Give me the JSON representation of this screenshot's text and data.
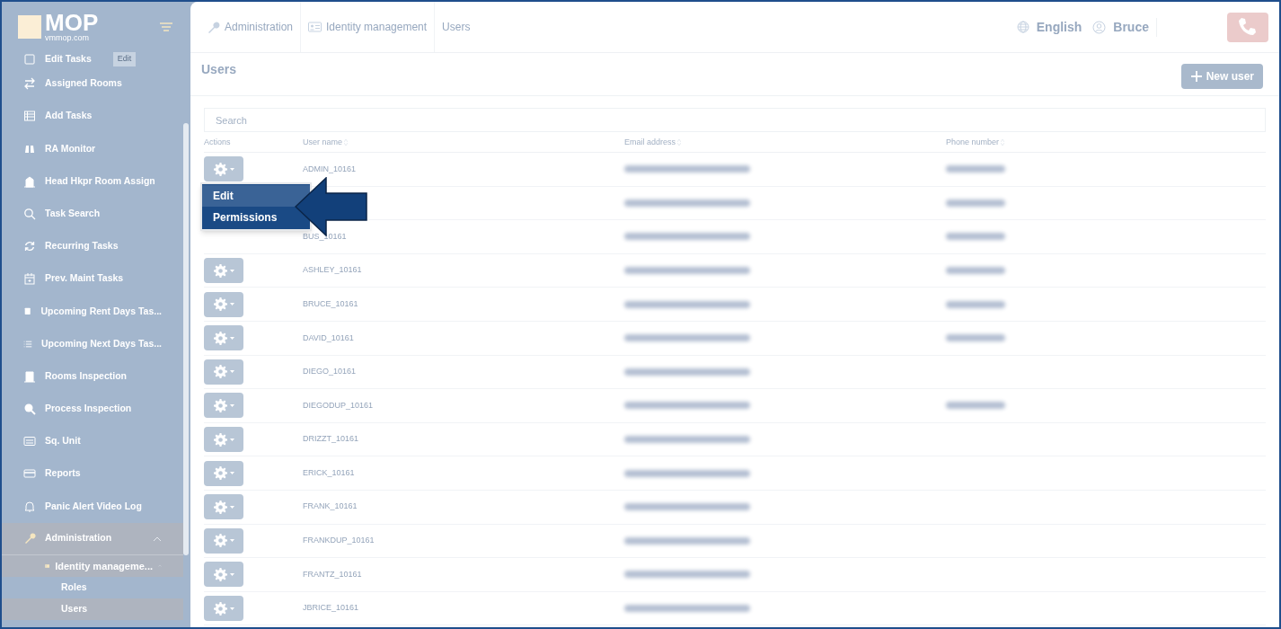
{
  "logo": {
    "title": "MOP",
    "subtitle": "vmmop.com"
  },
  "sidebar": {
    "items": [
      {
        "label": "Edit Tasks",
        "badge": "Edit"
      },
      {
        "label": "Assigned Rooms"
      },
      {
        "label": "Add Tasks"
      },
      {
        "label": "RA Monitor"
      },
      {
        "label": "Head Hkpr Room Assign"
      },
      {
        "label": "Task Search"
      },
      {
        "label": "Recurring Tasks"
      },
      {
        "label": "Prev. Maint Tasks"
      },
      {
        "label": "Upcoming Rent Days Tas..."
      },
      {
        "label": "Upcoming Next Days Tas..."
      },
      {
        "label": "Rooms Inspection"
      },
      {
        "label": "Process Inspection"
      },
      {
        "label": "Sq. Unit"
      },
      {
        "label": "Reports"
      },
      {
        "label": "Panic Alert Video Log"
      },
      {
        "label": "Administration",
        "expanded": true,
        "children": [
          {
            "label": "Identity manageme...",
            "expanded": true,
            "children": [
              {
                "label": "Roles",
                "selected": false
              },
              {
                "label": "Users",
                "selected": true
              }
            ]
          }
        ]
      }
    ]
  },
  "breadcrumb": [
    "Administration",
    "Identity management",
    "Users"
  ],
  "header": {
    "language": "English",
    "user": "Bruce"
  },
  "page": {
    "title": "Users",
    "new_button": "New user"
  },
  "search": {
    "placeholder": "Search"
  },
  "table": {
    "columns": [
      "Actions",
      "User name",
      "Email address",
      "Phone number"
    ],
    "rows": [
      {
        "user_name": "ADMIN_10161",
        "actions": true,
        "menu_open": true,
        "email_redacted": true,
        "phone_redacted": true
      },
      {
        "actions": false,
        "menu_open": false,
        "email_redacted": true,
        "phone_redacted": true
      },
      {
        "user_name": "BUS_10161",
        "actions": false,
        "menu_open": false,
        "email_redacted": true,
        "phone_redacted": true
      },
      {
        "user_name": "ASHLEY_10161",
        "actions": true,
        "menu_open": false,
        "email_redacted": true,
        "phone_redacted": true
      },
      {
        "user_name": "BRUCE_10161",
        "actions": true,
        "menu_open": false,
        "email_redacted": true,
        "phone_redacted": true
      },
      {
        "user_name": "DAVID_10161",
        "actions": true,
        "menu_open": false,
        "email_redacted": true,
        "phone_redacted": true
      },
      {
        "user_name": "DIEGO_10161",
        "actions": true,
        "menu_open": false,
        "email_redacted": true,
        "phone_redacted": false
      },
      {
        "user_name": "DIEGODUP_10161",
        "actions": true,
        "menu_open": false,
        "email_redacted": true,
        "phone_redacted": true
      },
      {
        "user_name": "DRIZZT_10161",
        "actions": true,
        "menu_open": false,
        "email_redacted": true,
        "phone_redacted": false
      },
      {
        "user_name": "ERICK_10161",
        "actions": true,
        "menu_open": false,
        "email_redacted": true,
        "phone_redacted": false
      },
      {
        "user_name": "FRANK_10161",
        "actions": true,
        "menu_open": false,
        "email_redacted": true,
        "phone_redacted": false
      },
      {
        "user_name": "FRANKDUP_10161",
        "actions": true,
        "menu_open": false,
        "email_redacted": true,
        "phone_redacted": false
      },
      {
        "user_name": "FRANTZ_10161",
        "actions": true,
        "menu_open": false,
        "email_redacted": true,
        "phone_redacted": false
      },
      {
        "user_name": "JBRICE_10161",
        "actions": true,
        "menu_open": false,
        "email_redacted": true,
        "phone_redacted": false
      }
    ]
  },
  "action_menu": {
    "items": [
      {
        "label": "Edit",
        "selected": true
      },
      {
        "label": "Permissions",
        "selected": false
      }
    ]
  }
}
